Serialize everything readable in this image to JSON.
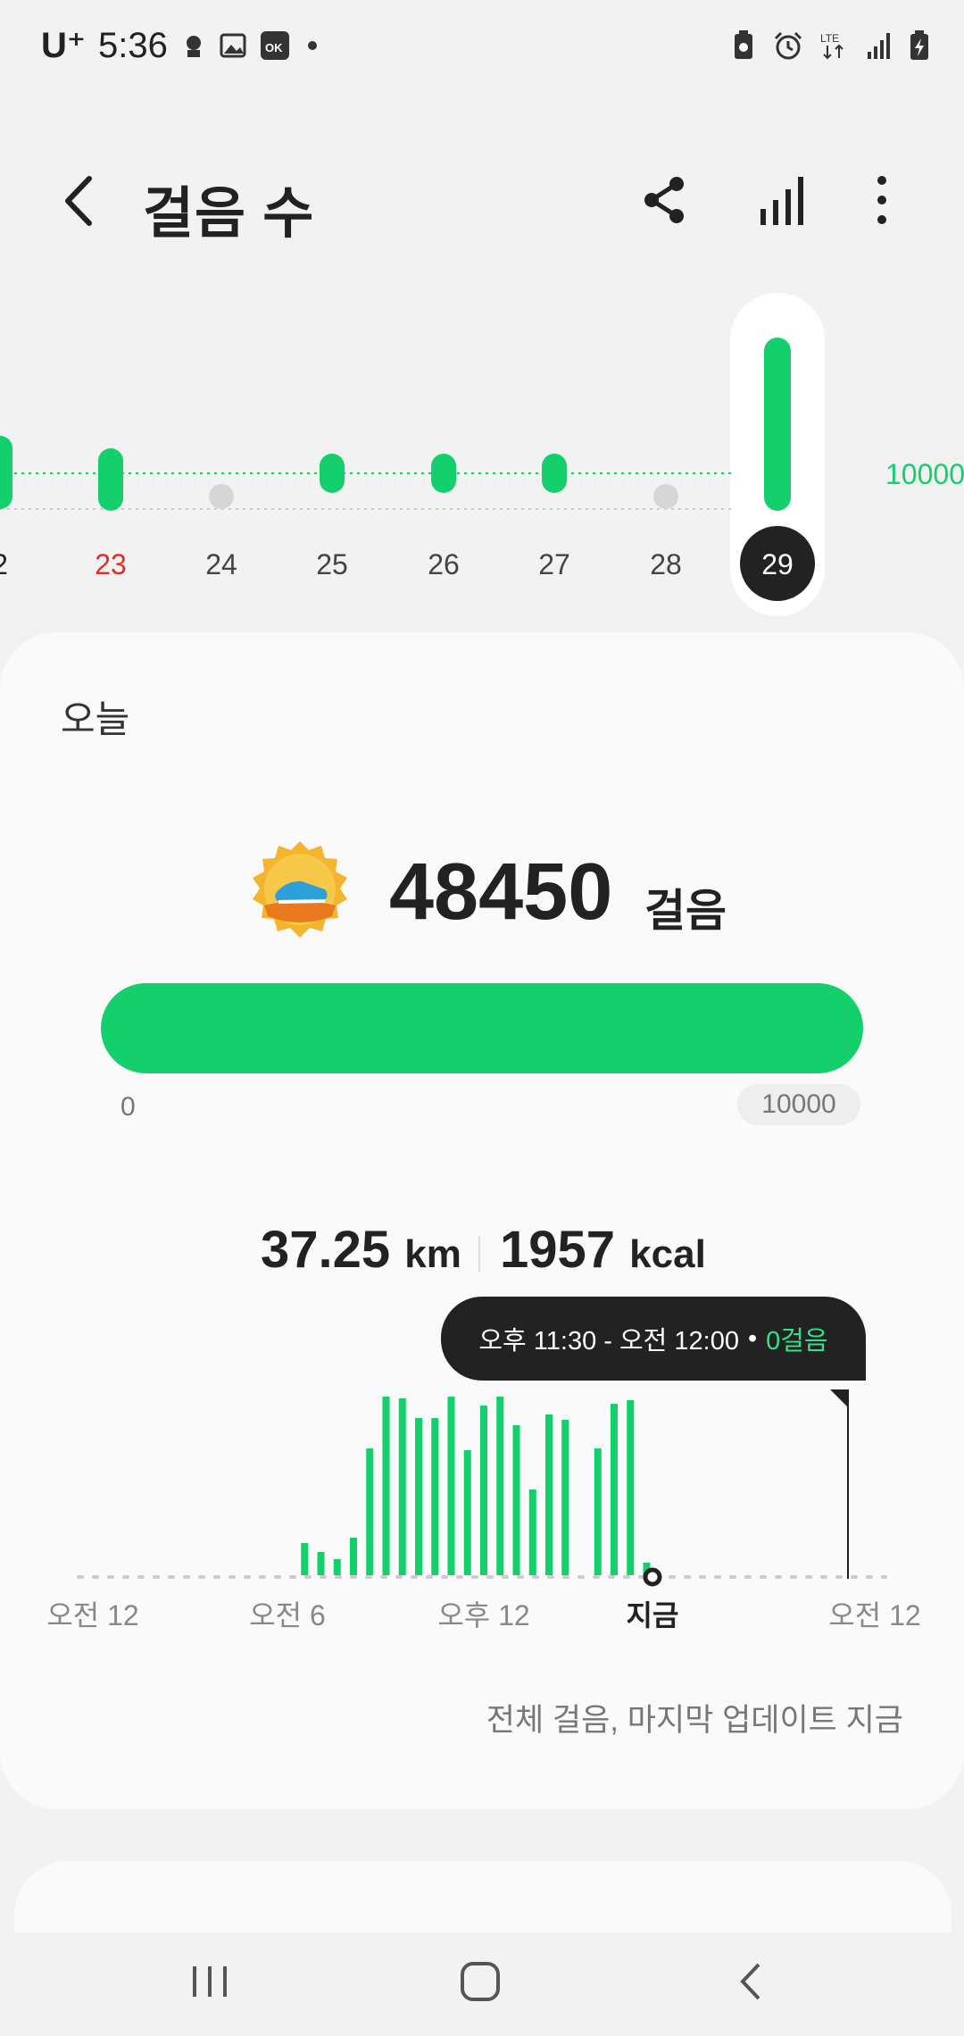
{
  "status_bar": {
    "carrier": "U⁺",
    "time": "5:36",
    "icons_left": [
      "notification-icon",
      "gallery-icon",
      "ok-cashbag-icon",
      "dot-icon"
    ],
    "icons_right": [
      "battery-saver-icon",
      "alarm-icon",
      "lte-icon",
      "signal-icon",
      "battery-charging-icon"
    ]
  },
  "header": {
    "title": "걸음 수",
    "actions": [
      "share-icon",
      "bar-chart-icon",
      "more-vert-icon"
    ]
  },
  "day_strip": {
    "goal_label": "10000",
    "days": [
      {
        "label": "2",
        "state": "partial",
        "color": "#222222"
      },
      {
        "label": "23",
        "state": "goal",
        "color": "#d8302a"
      },
      {
        "label": "24",
        "state": "none",
        "color": "#444444"
      },
      {
        "label": "25",
        "state": "goal",
        "color": "#444444"
      },
      {
        "label": "26",
        "state": "goal",
        "color": "#444444"
      },
      {
        "label": "27",
        "state": "goal",
        "color": "#444444"
      },
      {
        "label": "28",
        "state": "none",
        "color": "#444444"
      },
      {
        "label": "29",
        "state": "selected",
        "color": "#ffffff"
      }
    ]
  },
  "today": {
    "label": "오늘",
    "steps": "48450",
    "steps_unit": "걸음",
    "progress_min": "0",
    "progress_max": "10000",
    "progress_fraction": 1.0,
    "distance_value": "37.25",
    "distance_unit": "km",
    "calories_value": "1957",
    "calories_unit": "kcal",
    "tooltip": {
      "range": "오후 11:30 - 오전 12:00",
      "separator": "•",
      "steps": "0걸음"
    },
    "hourly_axis": [
      "오전 12",
      "오전 6",
      "오후 12",
      "지금",
      "오전 12"
    ],
    "footnote": "전체 걸음, 마지막 업데이트 지금"
  },
  "chart_data": {
    "type": "bar",
    "x": [
      13,
      14,
      15,
      16,
      17,
      18,
      19,
      20,
      21,
      22,
      23,
      24,
      25,
      26,
      27,
      28,
      29,
      31,
      32,
      33,
      34,
      35,
      36,
      37
    ],
    "values": [
      0.18,
      0.13,
      0.09,
      0.21,
      0.71,
      1.0,
      0.99,
      0.88,
      0.88,
      1.0,
      0.7,
      0.95,
      1.0,
      0.84,
      0.48,
      0.9,
      0.87,
      0.71,
      0.96,
      0.98,
      0.07,
      0,
      0,
      0
    ],
    "xlim": [
      0,
      48
    ],
    "colors": {
      "bar": "#13cf6c",
      "grid": "#cccccc"
    }
  },
  "nav_bar": [
    "recent-apps-icon",
    "home-icon",
    "back-icon"
  ],
  "colors": {
    "accent": "#13cf6c",
    "dark": "#222222",
    "date_red": "#d8302a"
  }
}
